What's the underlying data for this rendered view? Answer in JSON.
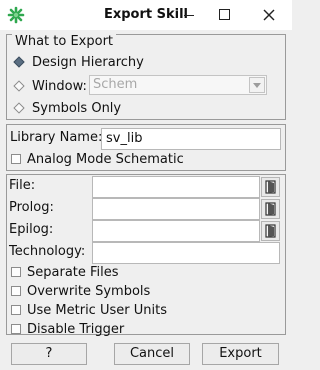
{
  "window": {
    "title": "Export Skill",
    "icon": "green-star-icon"
  },
  "export_group": {
    "legend": "What to Export",
    "options": [
      {
        "label": "Design Hierarchy",
        "selected": true
      },
      {
        "label": "Window:",
        "selected": false
      },
      {
        "label": "Symbols Only",
        "selected": false
      }
    ],
    "window_select": {
      "value": "Schem",
      "disabled": true
    }
  },
  "library_group": {
    "library_name_label": "Library Name:",
    "library_name_value": "sv_lib",
    "analog_mode_label": "Analog Mode Schematic",
    "analog_mode_checked": false
  },
  "files_group": {
    "file_label": "File:",
    "file_value": "",
    "prolog_label": "Prolog:",
    "prolog_value": "",
    "epilog_label": "Epilog:",
    "epilog_value": "",
    "technology_label": "Technology:",
    "technology_value": "",
    "options": [
      {
        "label": "Separate Files",
        "checked": false
      },
      {
        "label": "Overwrite Symbols",
        "checked": false
      },
      {
        "label": "Use Metric User Units",
        "checked": false
      },
      {
        "label": "Disable Trigger",
        "checked": false
      }
    ]
  },
  "buttons": {
    "help": "?",
    "cancel": "Cancel",
    "export": "Export"
  },
  "colors": {
    "selected_radio": "#5a6e82",
    "icon_green": "#2fa84f"
  }
}
